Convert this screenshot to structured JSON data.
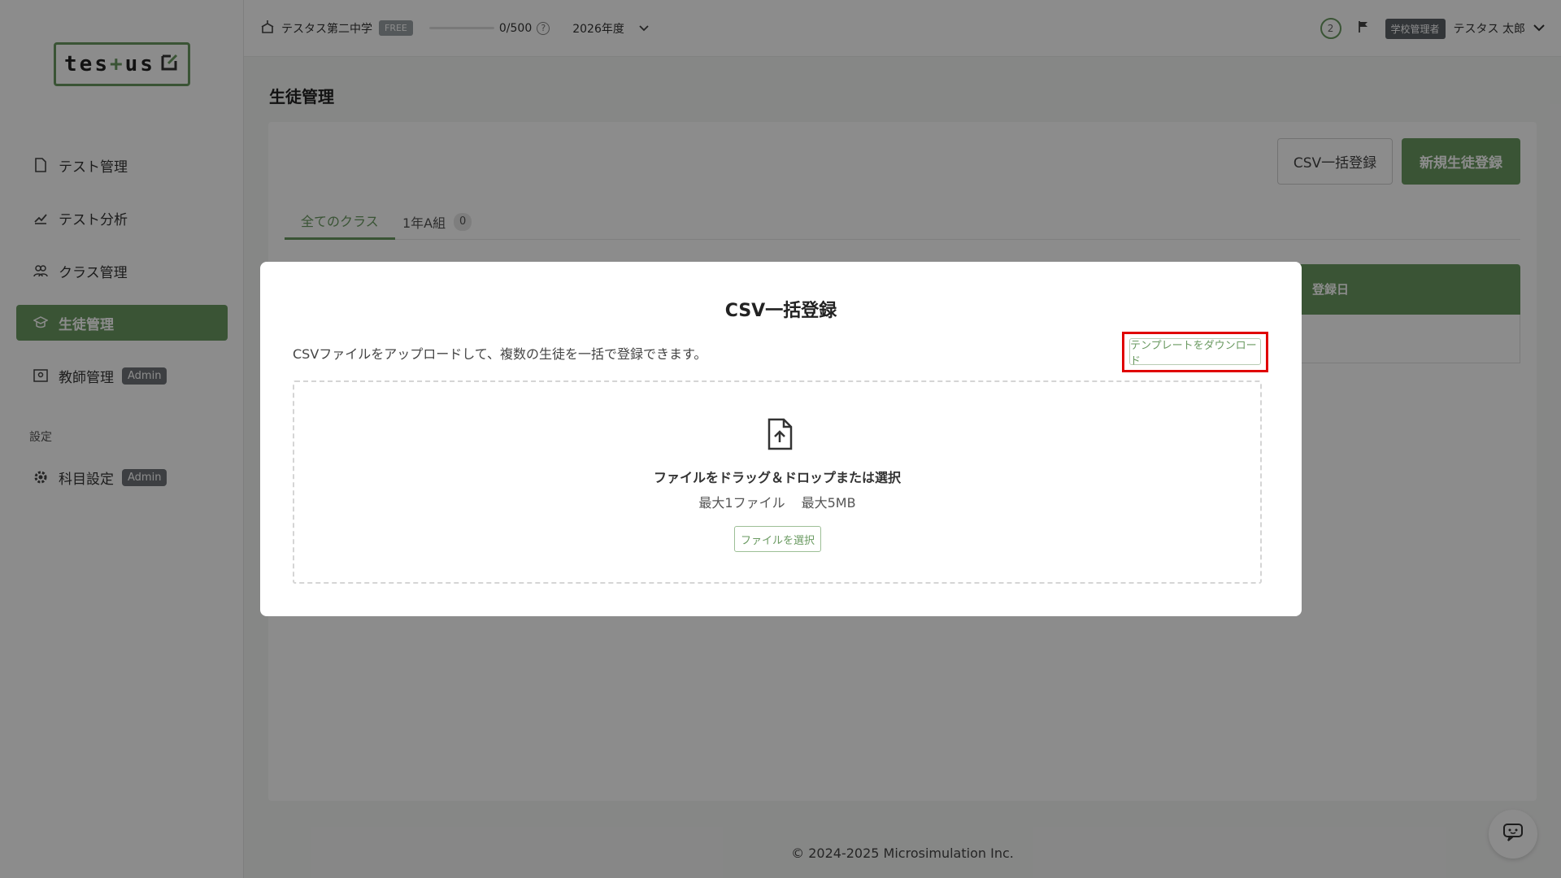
{
  "app": {
    "logo_text_a": "tes",
    "logo_text_plus": "+",
    "logo_text_b": "us"
  },
  "sidebar": {
    "items": [
      {
        "label": "テスト管理"
      },
      {
        "label": "テスト分析"
      },
      {
        "label": "クラス管理"
      },
      {
        "label": "生徒管理"
      },
      {
        "label": "教師管理",
        "badge": "Admin"
      }
    ],
    "section_label": "設定",
    "settings_items": [
      {
        "label": "科目設定",
        "badge": "Admin"
      }
    ]
  },
  "topbar": {
    "school_name": "テスタス第二中学",
    "plan_badge": "FREE",
    "quota_text": "0/500",
    "quota_fraction": 0,
    "year": "2026年度",
    "notification_count": "2",
    "role": "学校管理者",
    "user_name": "テスタス 太郎"
  },
  "page": {
    "title": "生徒管理",
    "csv_button": "CSV一括登録",
    "new_button": "新規生徒登録",
    "tabs": [
      {
        "label": "全てのクラス"
      },
      {
        "label": "1年A組",
        "count": "0"
      }
    ],
    "table_col_date": "登録日"
  },
  "modal": {
    "title": "CSV一括登録",
    "description": "CSVファイルをアップロードして、複数の生徒を一括で登録できます。",
    "template_button": "テンプレートをダウンロード",
    "dropzone_title": "ファイルをドラッグ＆ドロップまたは選択",
    "max_files": "最大1ファイル",
    "max_size": "最大5MB",
    "select_button": "ファイルを選択"
  },
  "footer": {
    "copyright": "© 2024-2025 Microsimulation Inc."
  },
  "colors": {
    "accent": "#6a9a61",
    "highlight": "#e00000"
  }
}
